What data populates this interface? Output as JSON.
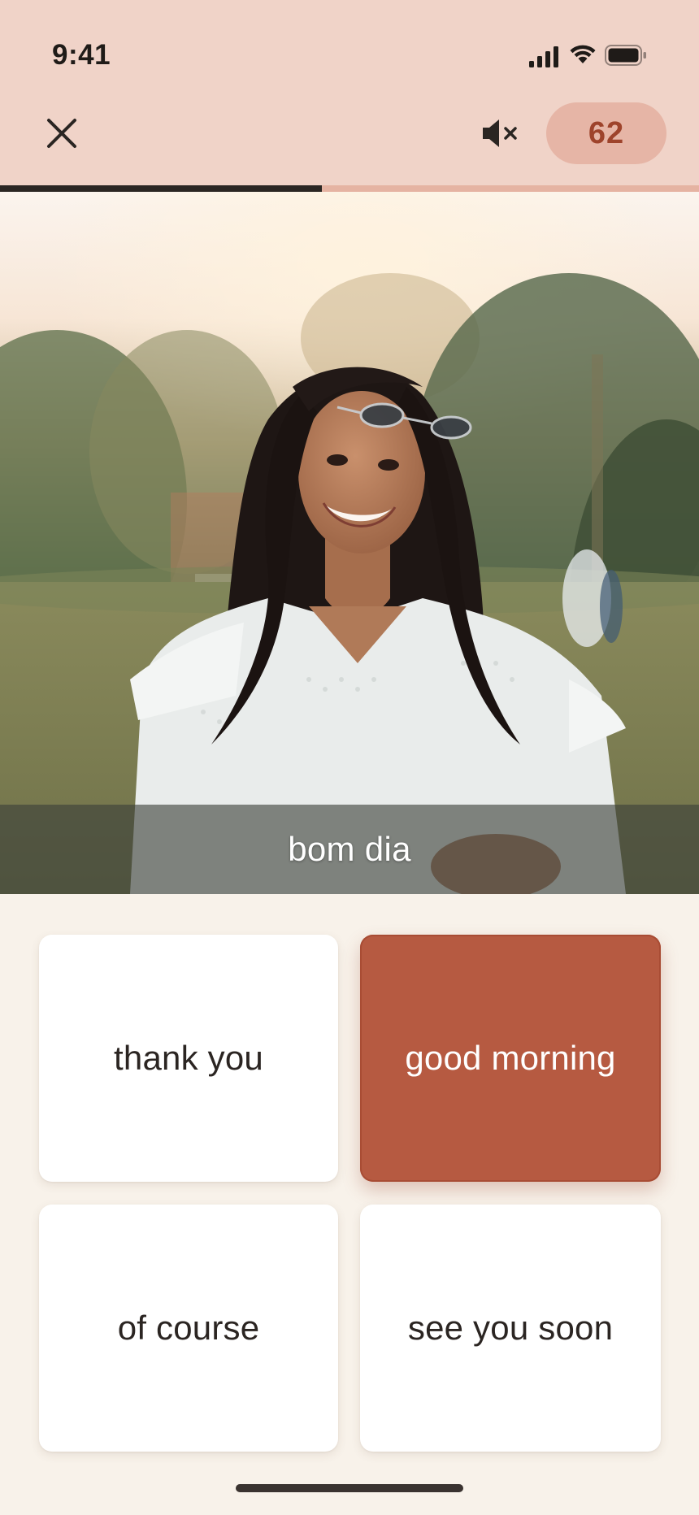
{
  "status_bar": {
    "time": "9:41",
    "icons": [
      "cellular-signal-icon",
      "wifi-icon",
      "battery-icon"
    ]
  },
  "header": {
    "close_icon": "close-icon",
    "mute_icon": "speaker-muted-icon",
    "score": "62"
  },
  "progress": {
    "fraction": 0.46
  },
  "prompt": {
    "image_subject": "smiling woman outdoors photo",
    "caption": "bom dia"
  },
  "answers": [
    {
      "label": "thank you",
      "selected": false
    },
    {
      "label": "good morning",
      "selected": true
    },
    {
      "label": "of course",
      "selected": false
    },
    {
      "label": "see you soon",
      "selected": false
    }
  ],
  "colors": {
    "header_bg": "#F0D3C8",
    "score_pill": "#E6B5A6",
    "score_text": "#9E432B",
    "accent_selected": "#B65A41",
    "page_bg": "#F8F2EA",
    "progress_fill": "#2B2623",
    "progress_track": "#E5B3A2"
  }
}
